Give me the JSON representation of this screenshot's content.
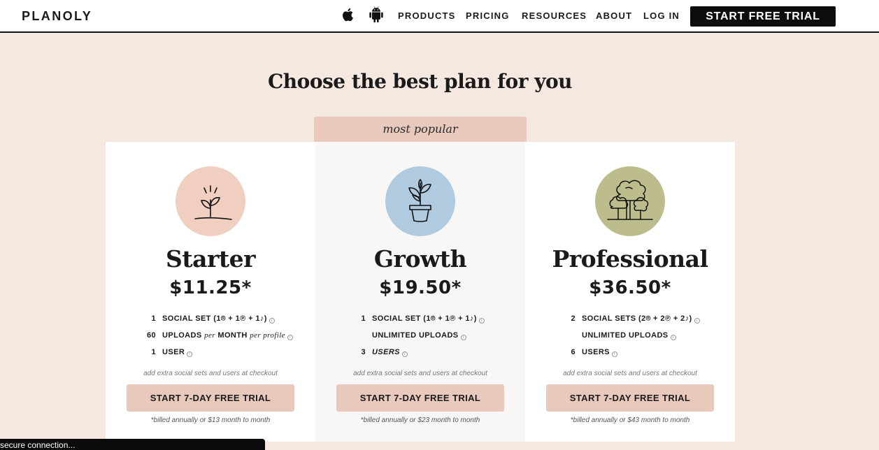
{
  "header": {
    "logo": "PLANOLY",
    "nav": [
      "PRODUCTS",
      "PRICING",
      "RESOURCES",
      "ABOUT",
      "LOG IN"
    ],
    "cta": "START FREE TRIAL"
  },
  "page": {
    "title": "Choose the best plan for you",
    "popular_label": "most popular"
  },
  "plans": [
    {
      "name": "Starter",
      "price": "$11.25*",
      "icon": "sprout-icon",
      "icon_color": "#f0cfc1",
      "features": [
        {
          "num": "1",
          "text": "SOCIAL SET (1",
          "tail": " + 1",
          "tail2": " + 1",
          "tail3": ")"
        },
        {
          "num": "60",
          "text": "UPLOADS",
          "per": "per",
          "month": "MONTH",
          "per_profile": "per profile"
        },
        {
          "num": "1",
          "text": "USER"
        }
      ],
      "note": "add extra social sets and users at checkout",
      "button": "START 7-DAY FREE TRIAL",
      "billed": "*billed annually or $13 month to month"
    },
    {
      "name": "Growth",
      "price": "$19.50*",
      "icon": "potted-plant-icon",
      "icon_color": "#b0cbdf",
      "features": [
        {
          "num": "1",
          "text": "SOCIAL SET (1",
          "tail": " + 1",
          "tail2": " + 1",
          "tail3": ")"
        },
        {
          "num": "",
          "text": "UNLIMITED UPLOADS"
        },
        {
          "num": "3",
          "text": "USERS"
        }
      ],
      "note": "add extra social sets and users at checkout",
      "button": "START 7-DAY FREE TRIAL",
      "billed": "*billed annually or $23 month to month"
    },
    {
      "name": "Professional",
      "price": "$36.50*",
      "icon": "trees-icon",
      "icon_color": "#bcbc8d",
      "features": [
        {
          "num": "2",
          "text": "SOCIAL SETS (2",
          "tail": " + 2",
          "tail2": " + 2",
          "tail3": ")"
        },
        {
          "num": "",
          "text": "UNLIMITED UPLOADS"
        },
        {
          "num": "6",
          "text": "USERS"
        }
      ],
      "note": "add extra social sets and users at checkout",
      "button": "START 7-DAY FREE TRIAL",
      "billed": "*billed annually or $43 month to month"
    }
  ],
  "status": "secure connection..."
}
